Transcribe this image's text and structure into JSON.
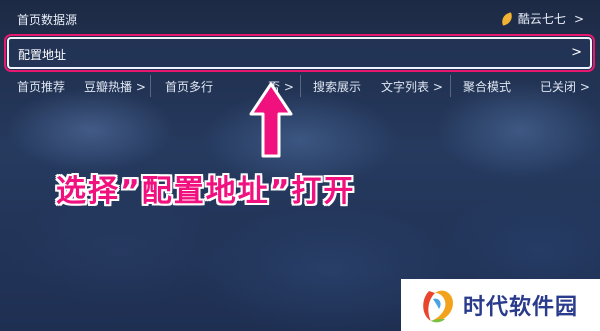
{
  "top_row": {
    "label": "首页数据源",
    "value": "酷云七七",
    "chevron": ">"
  },
  "config_row": {
    "label": "配置地址",
    "chevron": ">"
  },
  "menu": [
    {
      "label": "首页推荐"
    },
    {
      "label": "豆瓣热播 >"
    },
    {
      "label": "首页多行"
    },
    {
      "label": "否 >"
    },
    {
      "label": "搜索展示"
    },
    {
      "label": "文字列表 >"
    },
    {
      "label": "聚合模式"
    },
    {
      "label": "已关闭 >"
    }
  ],
  "annotation": {
    "text": "选择”配置地址”打开"
  },
  "watermark": {
    "text": "时代软件园"
  },
  "colors": {
    "highlight": "#e8176f",
    "annotation": "#f0107e",
    "watermark_text": "#2a3a8c"
  },
  "icons": {
    "source": "leaf-icon",
    "arrow": "up-arrow-annotation"
  }
}
